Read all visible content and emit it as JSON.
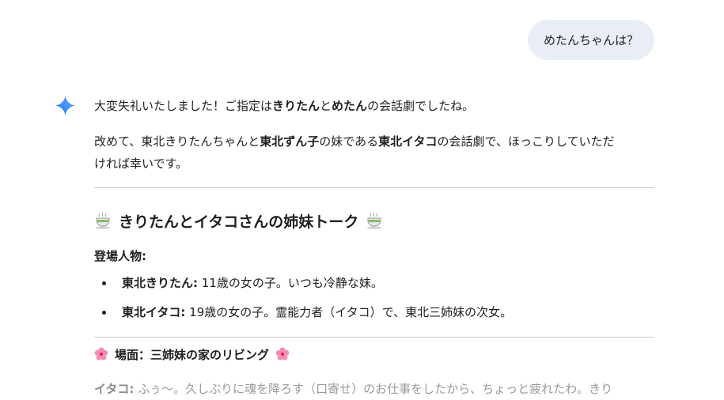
{
  "user_message": "めたんちゃんは？",
  "response": {
    "p1": {
      "a": "大変失礼いたしました！ご指定は",
      "b1": "きりたん",
      "c": "と",
      "b2": "めたん",
      "d": "の会話劇でしたね。"
    },
    "p2": {
      "a": "改めて、東北きりたんちゃんと",
      "b1": "東北ずん子",
      "c": "の妹である",
      "b2": "東北イタコ",
      "d": "の会話劇で、ほっこりしていただ",
      "e": "ければ幸いです。"
    },
    "heading": "きりたんとイタコさんの姉妹トーク",
    "characters_label": "登場人物:",
    "characters": [
      {
        "name": "東北きりたん:",
        "desc": " 11歳の女の子。いつも冷静な妹。"
      },
      {
        "name": "東北イタコ:",
        "desc": " 19歳の女の子。霊能力者（イタコ）で、東北三姉妹の次女。"
      }
    ],
    "scene": "場面：三姉妹の家のリビング",
    "dialogue_1": {
      "speaker": "イタコ:",
      "text": " ふぅ〜。久しぶりに魂を降ろす（口寄せ）のお仕事をしたから、ちょっと疲れたわ。きり"
    }
  },
  "icons": {
    "assistant": "gemini-sparkle-icon",
    "heading": "tea-cup-icon",
    "scene": "cherry-blossom-icon"
  },
  "colors": {
    "user_bubble": "#e9eef6",
    "text": "#1f1f1f",
    "divider": "#c7c7c7",
    "sparkle_blue": "#4285f4",
    "blossom_pink": "#f06292"
  }
}
